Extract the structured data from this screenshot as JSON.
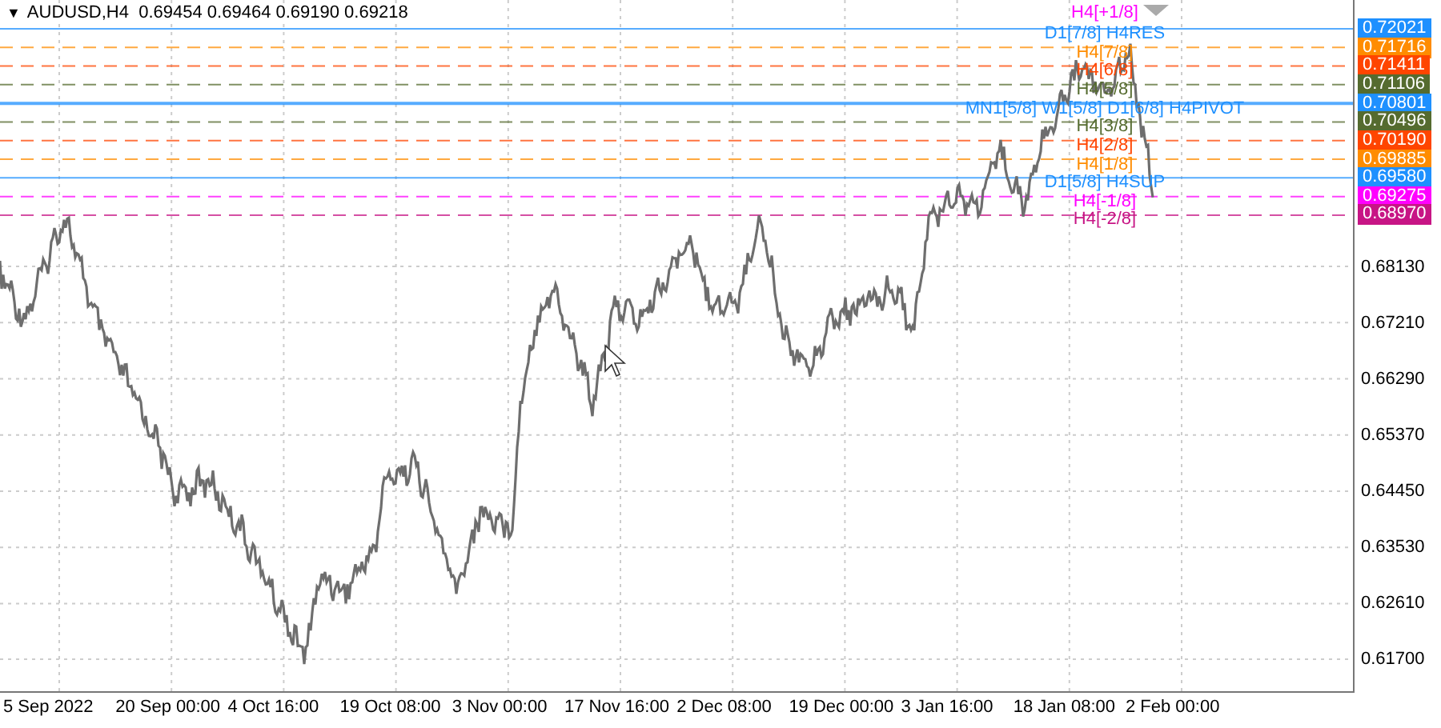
{
  "header": {
    "toggle": "▼",
    "symbol": "AUDUSD,H4  0.69454 0.69464 0.69190 0.69218"
  },
  "levels": [
    {
      "label": "H4[+1/8]",
      "color": "#ff00ff"
    },
    {
      "label": "D1[7/8] H4RES",
      "price": "0.72021",
      "color": "#1e90ff",
      "kind": "solid"
    },
    {
      "label": "H4[7/8]",
      "price": "0.71716",
      "color": "#ff8c00",
      "kind": "dash"
    },
    {
      "label": "H4[6/8]",
      "price": "0.71411",
      "color": "#ff4500",
      "kind": "dash"
    },
    {
      "label": "H4[5/8]",
      "price": "0.71106",
      "color": "#556b2f",
      "kind": "dash"
    },
    {
      "label": "MN1[5/8] W1[5/8] D1[6/8] H4PIVOT",
      "price": "0.70801",
      "color": "#1e90ff",
      "kind": "thick"
    },
    {
      "label": "H4[3/8]",
      "price": "0.70496",
      "color": "#556b2f",
      "kind": "dash"
    },
    {
      "label": "H4[2/8]",
      "price": "0.70190",
      "color": "#ff4500",
      "kind": "dash"
    },
    {
      "label": "H4[1/8]",
      "price": "0.69885",
      "color": "#ff8c00",
      "kind": "dash"
    },
    {
      "label": "D1[5/8] H4SUP",
      "price": "0.69580",
      "color": "#1e90ff",
      "kind": "solid"
    },
    {
      "label": "H4[-1/8]",
      "price": "0.69275",
      "color": "#ff00ff",
      "kind": "dash"
    },
    {
      "label": "H4[-2/8]",
      "price": "0.68970",
      "color": "#c71585",
      "kind": "dash"
    }
  ],
  "price_axis": [
    "0.68130",
    "0.67210",
    "0.66290",
    "0.65370",
    "0.64450",
    "0.63530",
    "0.62610",
    "0.61700"
  ],
  "time_axis": [
    "5 Sep 2022",
    "20 Sep 00:00",
    "4 Oct 16:00",
    "19 Oct 08:00",
    "3 Nov 00:00",
    "17 Nov 16:00",
    "2 Dec 08:00",
    "19 Dec 00:00",
    "3 Jan 16:00",
    "18 Jan 08:00",
    "2 Feb 00:00"
  ]
}
